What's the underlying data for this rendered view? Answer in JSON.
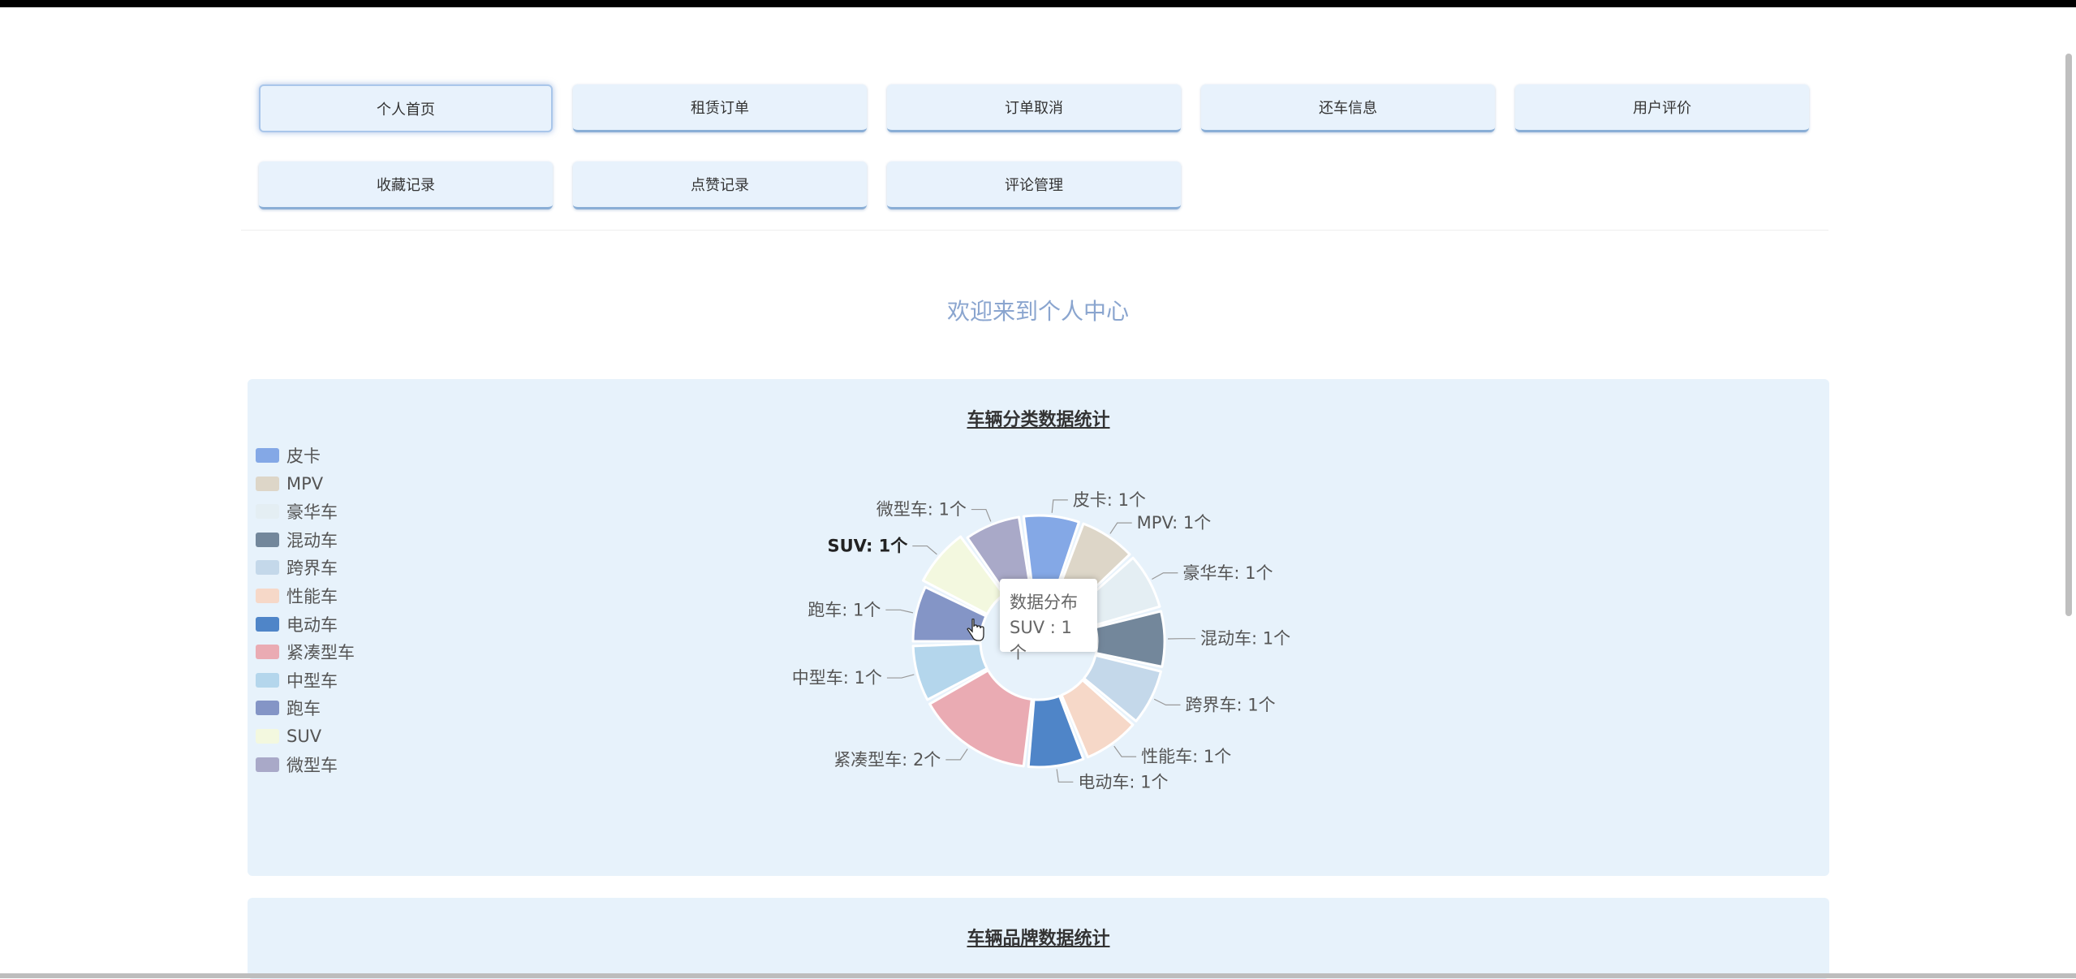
{
  "nav": {
    "items": [
      {
        "label": "个人首页",
        "active": true
      },
      {
        "label": "租赁订单",
        "active": false
      },
      {
        "label": "订单取消",
        "active": false
      },
      {
        "label": "还车信息",
        "active": false
      },
      {
        "label": "用户评价",
        "active": false
      },
      {
        "label": "收藏记录",
        "active": false
      },
      {
        "label": "点赞记录",
        "active": false
      },
      {
        "label": "评论管理",
        "active": false
      }
    ]
  },
  "welcome": "欢迎来到个人中心",
  "panels": {
    "category_title": "车辆分类数据统计",
    "brand_title": "车辆品牌数据统计"
  },
  "tooltip": {
    "title": "数据分布",
    "value": "SUV : 1个"
  },
  "chart_data": {
    "type": "pie",
    "title": "车辆分类数据统计",
    "legend_position": "left",
    "categories": [
      "皮卡",
      "MPV",
      "豪华车",
      "混动车",
      "跨界车",
      "性能车",
      "电动车",
      "紧凑型车",
      "中型车",
      "跑车",
      "SUV",
      "微型车"
    ],
    "values": [
      1,
      1,
      1,
      1,
      1,
      1,
      1,
      2,
      1,
      1,
      1,
      1
    ],
    "unit": "个",
    "colors": [
      "#84a8e6",
      "#ddd6c8",
      "#e4eef3",
      "#73879b",
      "#c4d8ea",
      "#f6d8c8",
      "#4f85c8",
      "#eaabb3",
      "#b4d6ec",
      "#8495c6",
      "#f3f8df",
      "#a9a9c8"
    ],
    "highlighted": "SUV"
  }
}
